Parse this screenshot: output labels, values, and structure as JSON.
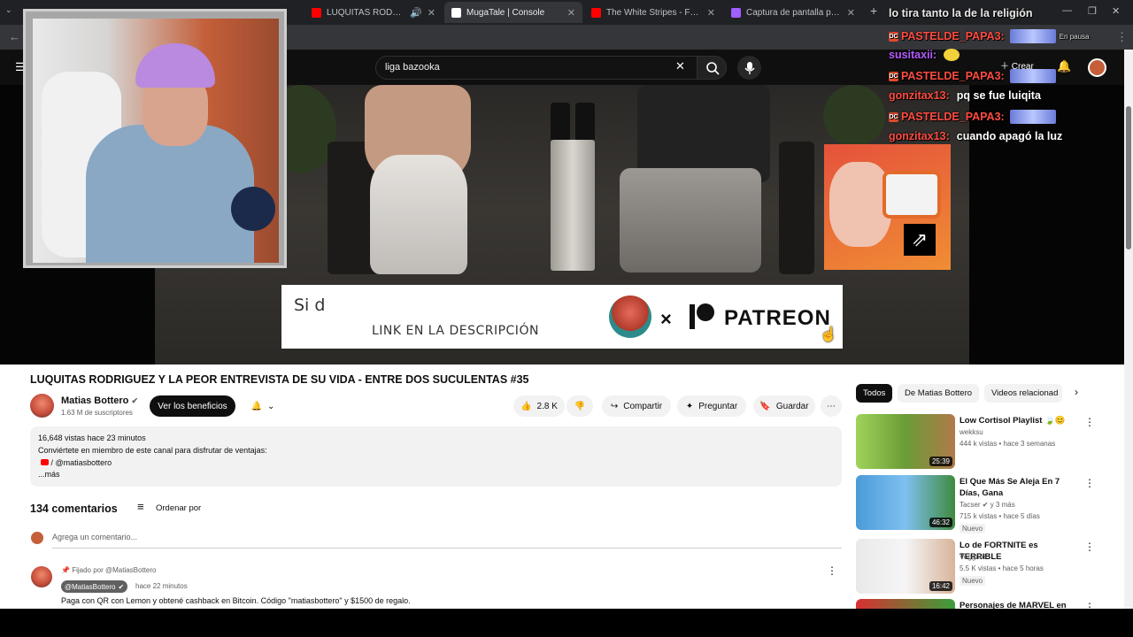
{
  "browser": {
    "tabs": [
      {
        "title": "",
        "favicon_color": "#e74c3c"
      },
      {
        "title": "",
        "favicon_color": "#ff0000"
      },
      {
        "title": "LUQUITAS RODRIGUEZ Y LA",
        "favicon_color": "#ff0000"
      },
      {
        "title": "MugaTale | Console",
        "favicon_color": "#ffffff"
      },
      {
        "title": "The White Stripes - Fell In Love",
        "favicon_color": "#ff0000"
      },
      {
        "title": "Captura de pantalla por Lightsl",
        "favicon_color": "#a05fff"
      }
    ],
    "new_tab": "+"
  },
  "youtube": {
    "search_value": "liga bazooka",
    "create_label": "Crear",
    "video_title": "LUQUITAS RODRIGUEZ Y LA PEOR ENTREVISTA DE SU VIDA - ENTRE DOS SUCULENTAS #35",
    "channel_name": "Matias Bottero",
    "subscribers": "1.63 M de suscriptores",
    "benefits_label": "Ver los beneficios",
    "likes": "2.8 K",
    "share_label": "Compartir",
    "ask_label": "Preguntar",
    "save_label": "Guardar",
    "banner": {
      "top_text": "Si d",
      "link_text": "LINK EN LA DESCRIPCIÓN",
      "x": "×",
      "patreon": "PATREON"
    },
    "description": {
      "views_time": "16,648 vistas  hace 23 minutos",
      "line2": "Conviértete en miembro de este canal para disfrutar de ventajas:",
      "line3": "/ @matiasbottero",
      "more": "...más"
    },
    "comments_count": "134 comentarios",
    "sort_label": "Ordenar por",
    "add_comment_placeholder": "Agrega un comentario...",
    "pinned_comment": {
      "pinned_by": "Fijado por @MatiasBottero",
      "author": "@MatiasBottero",
      "time": "hace 22 minutos",
      "text": "Paga con QR con Lemon y obtené cashback en Bitcoin. Código \"matiasbottero\" y $1500 de regalo."
    },
    "chips": [
      "Todos",
      "De Matias Bottero",
      "Videos relacionad"
    ],
    "related": [
      {
        "title": "Low Cortisol Playlist 🍃😊",
        "channel": "wekksu",
        "meta": "444 k vistas • hace 3 semanas",
        "duration": "25:39",
        "badge": "",
        "thumb": "#7fbf3f"
      },
      {
        "title": "El Que Más Se Aleja En 7 Días, Gana",
        "channel": "Tacser ✔ y 3 más",
        "meta": "715 k vistas • hace 5 días",
        "duration": "46:32",
        "badge": "Nuevo",
        "thumb": "#3a8fd0"
      },
      {
        "title": "Lo de FORTNITE es TERRIBLE",
        "channel": "Voggard",
        "meta": "5.5 K vistas • hace 5 horas",
        "duration": "16:42",
        "badge": "Nuevo",
        "thumb": "#dcdcdc"
      },
      {
        "title": "Personajes de MARVEL en",
        "channel": "",
        "meta": "",
        "duration": "",
        "badge": "",
        "thumb": "#d83030"
      }
    ]
  },
  "chat": {
    "lines": [
      {
        "user": "",
        "msg": "lo tira tanto la de la religión"
      },
      {
        "user": "PASTELDE_PAPA3:",
        "msg": "",
        "extra": "En pausa"
      },
      {
        "user": "susitaxii:",
        "msg": ""
      },
      {
        "user": "PASTELDE_PAPA3:",
        "msg": ""
      },
      {
        "user": "gonzitax13:",
        "msg": "pq se fue luiqita"
      },
      {
        "user": "PASTELDE_PAPA3:",
        "msg": ""
      },
      {
        "user": "gonzitax13:",
        "msg": "cuando apagó la luz"
      }
    ]
  },
  "colors": {
    "brand_red": "#ff0000",
    "chat_red": "#ff4c41",
    "chat_purple": "#b45cff"
  }
}
